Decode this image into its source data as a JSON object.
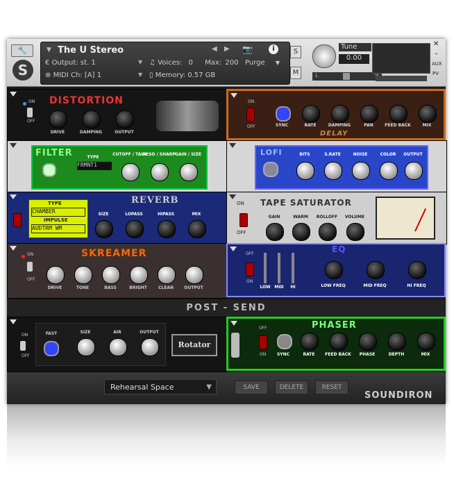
{
  "header": {
    "instrument_name": "The U Stereo",
    "output_label": "Output:",
    "output_value": "st. 1",
    "voices_label": "Voices:",
    "voices_value": "0",
    "max_label": "Max:",
    "max_value": "200",
    "purge_label": "Purge",
    "midi_label": "MIDI Ch:",
    "midi_value": "[A]  1",
    "memory_label": "Memory:",
    "memory_value": "0.57 GB",
    "s_label": "S",
    "m_label": "M",
    "tune_label": "Tune",
    "tune_value": "0.00",
    "aux_label": "AUX",
    "pv_label": "PV",
    "pan_l": "L",
    "pan_r": "R"
  },
  "modules": {
    "distortion": {
      "title": "DISTORTION",
      "on": "ON",
      "off": "OFF",
      "knobs": [
        "DRIVE",
        "DAMPING",
        "OUTPUT"
      ]
    },
    "delay": {
      "title": "DELAY",
      "on": "ON",
      "off": "OFF",
      "knobs": [
        "SYNC",
        "RATE",
        "DAMPING",
        "PAN",
        "FEED BACK",
        "MIX"
      ]
    },
    "filter": {
      "title": "FILTER",
      "type_label": "TYPE",
      "type_value": "FRMNT1",
      "knobs": [
        "CUTOFF / TALK",
        "RESO / SHARP",
        "GAIN / SIZE"
      ]
    },
    "lofi": {
      "title": "LOFI",
      "knobs": [
        "BITS",
        "S.RATE",
        "NOISE",
        "COLOR",
        "OUTPUT"
      ]
    },
    "reverb": {
      "title": "REVERB",
      "type_label": "TYPE",
      "type_value": "CHAMBER",
      "impulse_label": "IMPULSE",
      "impulse_value": "AUDTRM WM",
      "knobs": [
        "SIZE",
        "LOPASS",
        "HIPASS",
        "MIX"
      ]
    },
    "tape": {
      "title": "TAPE SATURATOR",
      "on": "ON",
      "off": "OFF",
      "knobs": [
        "GAIN",
        "WARM",
        "ROLLOFF",
        "VOLUME"
      ]
    },
    "skreamer": {
      "title": "SKREAMER",
      "on": "ON",
      "off": "OFF",
      "knobs": [
        "DRIVE",
        "TONE",
        "BASS",
        "BRIGHT",
        "CLEAN",
        "OUTPUT"
      ]
    },
    "eq": {
      "title": "EQ",
      "on": "ON",
      "off": "OFF",
      "sliders": [
        "LOW",
        "MID",
        "HI"
      ],
      "knobs": [
        "LOW FREQ",
        "MID FREQ",
        "HI FREQ"
      ]
    },
    "rotator": {
      "title": "Rotator",
      "on": "ON",
      "off": "OFF",
      "fast": "FAST",
      "knobs": [
        "SIZE",
        "AIR",
        "OUTPUT"
      ]
    },
    "phaser": {
      "title": "PHASER",
      "on": "ON",
      "off": "OFF",
      "knobs": [
        "SYNC",
        "RATE",
        "FEED BACK",
        "PHASE",
        "DEPTH",
        "MIX"
      ]
    }
  },
  "post_send": "POST - SEND",
  "footer": {
    "preset_value": "Rehearsal Space",
    "save": "SAVE",
    "delete": "DELETE",
    "reset": "RESET",
    "brand": "SOUNDIRON"
  }
}
